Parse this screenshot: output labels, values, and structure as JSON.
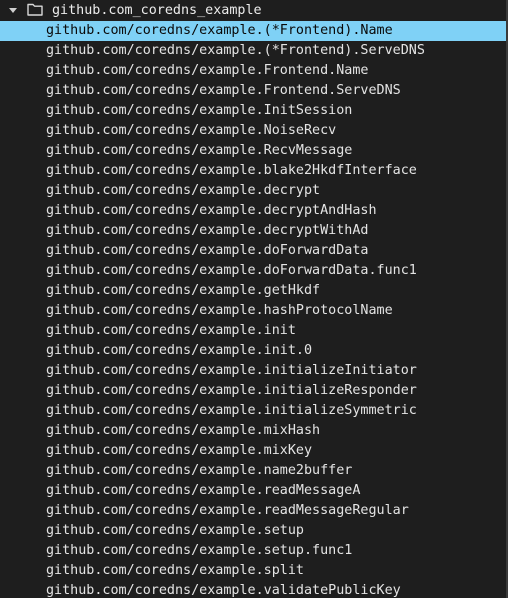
{
  "tree": {
    "folder_label": "github.com_coredns_example",
    "folder_icon": "folder-outline-icon",
    "caret_icon": "caret-down-icon",
    "selected_index": 0,
    "colors": {
      "background": "#1e1e1e",
      "selection": "#7fd1f6",
      "text": "#e4e4e4"
    },
    "items": [
      {
        "label": "github.com/coredns/example.(*Frontend).Name"
      },
      {
        "label": "github.com/coredns/example.(*Frontend).ServeDNS"
      },
      {
        "label": "github.com/coredns/example.Frontend.Name"
      },
      {
        "label": "github.com/coredns/example.Frontend.ServeDNS"
      },
      {
        "label": "github.com/coredns/example.InitSession"
      },
      {
        "label": "github.com/coredns/example.NoiseRecv"
      },
      {
        "label": "github.com/coredns/example.RecvMessage"
      },
      {
        "label": "github.com/coredns/example.blake2HkdfInterface"
      },
      {
        "label": "github.com/coredns/example.decrypt"
      },
      {
        "label": "github.com/coredns/example.decryptAndHash"
      },
      {
        "label": "github.com/coredns/example.decryptWithAd"
      },
      {
        "label": "github.com/coredns/example.doForwardData"
      },
      {
        "label": "github.com/coredns/example.doForwardData.func1"
      },
      {
        "label": "github.com/coredns/example.getHkdf"
      },
      {
        "label": "github.com/coredns/example.hashProtocolName"
      },
      {
        "label": "github.com/coredns/example.init"
      },
      {
        "label": "github.com/coredns/example.init.0"
      },
      {
        "label": "github.com/coredns/example.initializeInitiator"
      },
      {
        "label": "github.com/coredns/example.initializeResponder"
      },
      {
        "label": "github.com/coredns/example.initializeSymmetric"
      },
      {
        "label": "github.com/coredns/example.mixHash"
      },
      {
        "label": "github.com/coredns/example.mixKey"
      },
      {
        "label": "github.com/coredns/example.name2buffer"
      },
      {
        "label": "github.com/coredns/example.readMessageA"
      },
      {
        "label": "github.com/coredns/example.readMessageRegular"
      },
      {
        "label": "github.com/coredns/example.setup"
      },
      {
        "label": "github.com/coredns/example.setup.func1"
      },
      {
        "label": "github.com/coredns/example.split"
      },
      {
        "label": "github.com/coredns/example.validatePublicKey"
      }
    ]
  }
}
